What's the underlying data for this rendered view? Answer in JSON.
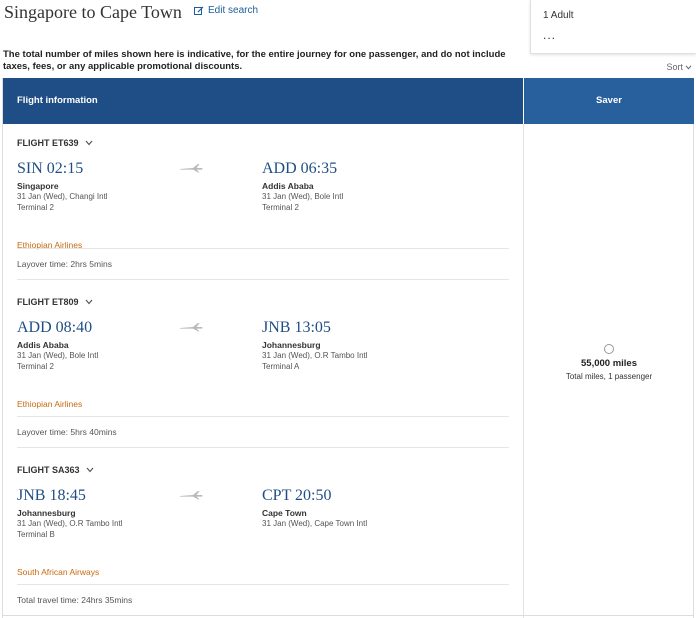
{
  "header": {
    "title": "Singapore to Cape Town",
    "edit_search": "Edit search"
  },
  "passengers": {
    "label": "1 Adult",
    "more": "..."
  },
  "disclaimer": "The total number of miles shown here is indicative, for the entire journey for one passenger, and do not include taxes, fees, or any applicable promotional discounts.",
  "sort_label": "Sort",
  "table": {
    "col_info": "Flight information",
    "col_saver": "Saver"
  },
  "flights": [
    {
      "code": "FLIGHT ET639",
      "dep_time": "SIN 02:15",
      "dep_city": "Singapore",
      "dep_date_airport": "31 Jan (Wed), Changi Intl",
      "dep_terminal": "Terminal 2",
      "arr_time": "ADD 06:35",
      "arr_city": "Addis Ababa",
      "arr_date_airport": "31 Jan (Wed), Bole Intl",
      "arr_terminal": "Terminal 2",
      "airline": "Ethiopian Airlines"
    },
    {
      "code": "FLIGHT ET809",
      "dep_time": "ADD 08:40",
      "dep_city": "Addis Ababa",
      "dep_date_airport": "31 Jan (Wed), Bole Intl",
      "dep_terminal": "Terminal 2",
      "arr_time": "JNB 13:05",
      "arr_city": "Johannesburg",
      "arr_date_airport": "31 Jan (Wed), O.R Tambo Intl",
      "arr_terminal": "Terminal A",
      "airline": "Ethiopian Airlines"
    },
    {
      "code": "FLIGHT SA363",
      "dep_time": "JNB 18:45",
      "dep_city": "Johannesburg",
      "dep_date_airport": "31 Jan (Wed), O.R Tambo Intl",
      "dep_terminal": "Terminal B",
      "arr_time": "CPT 20:50",
      "arr_city": "Cape Town",
      "arr_date_airport": "31 Jan (Wed), Cape Town Intl",
      "arr_terminal": "",
      "airline": "South African Airways"
    }
  ],
  "layovers": [
    "Layover time: 2hrs 5mins",
    "Layover time: 5hrs 40mins"
  ],
  "total_travel": "Total travel time: 24hrs 35mins",
  "saver": {
    "miles": "55,000 miles",
    "note": "Total miles, 1 passenger"
  },
  "colors": {
    "header_bg": "#1f4e86",
    "saver_bg": "#285f9d",
    "time_text": "#1f4e86",
    "airline_text": "#c76a10",
    "link": "#1a5e9b"
  },
  "icons": [
    "edit-icon",
    "chevron-down-icon",
    "plane-icon",
    "radio-icon"
  ]
}
